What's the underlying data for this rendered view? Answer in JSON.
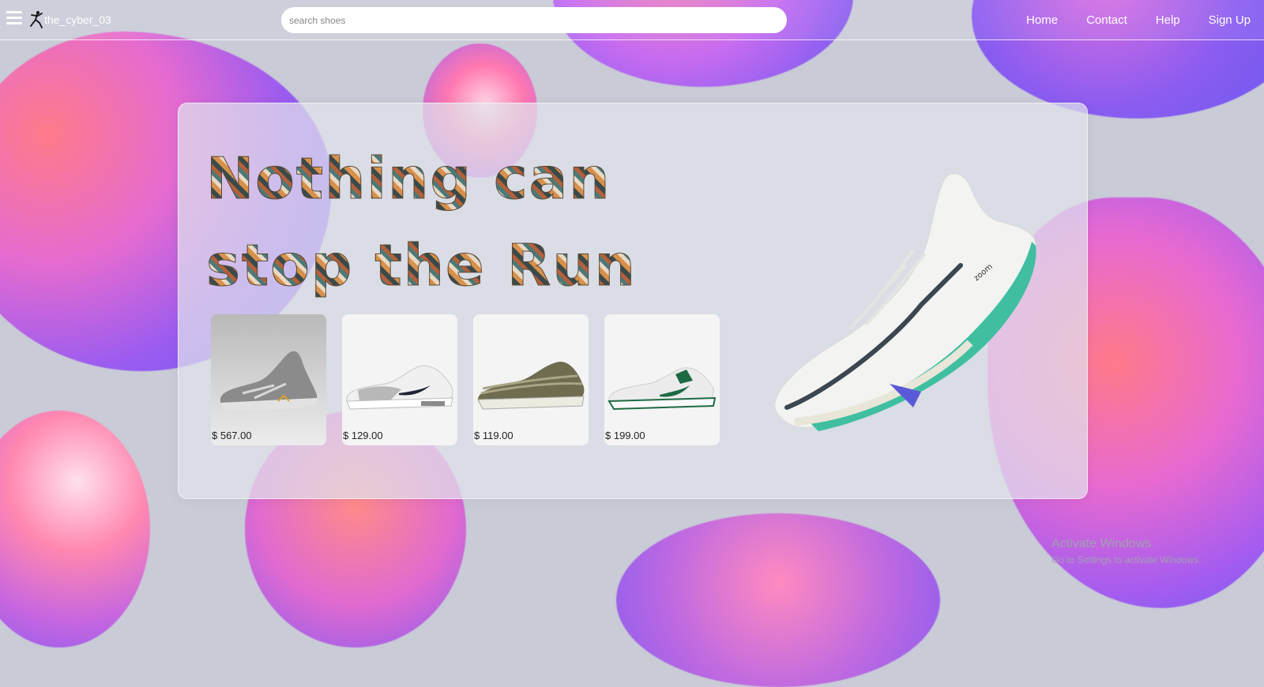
{
  "header": {
    "brand": "the_cyber_03",
    "search_placeholder": "search shoes",
    "nav": [
      "Home",
      "Contact",
      "Help",
      "Sign Up"
    ]
  },
  "hero": {
    "headline": "Nothing can stop the Run",
    "products": [
      {
        "price": "$ 567.00"
      },
      {
        "price": "$ 129.00"
      },
      {
        "price": "$ 119.00"
      },
      {
        "price": "$ 199.00"
      }
    ]
  },
  "watermark": {
    "title": "Activate Windows",
    "subtitle": "Go to Settings to activate Windows."
  },
  "icons": [
    "menu-icon",
    "jumpman-logo-icon"
  ]
}
